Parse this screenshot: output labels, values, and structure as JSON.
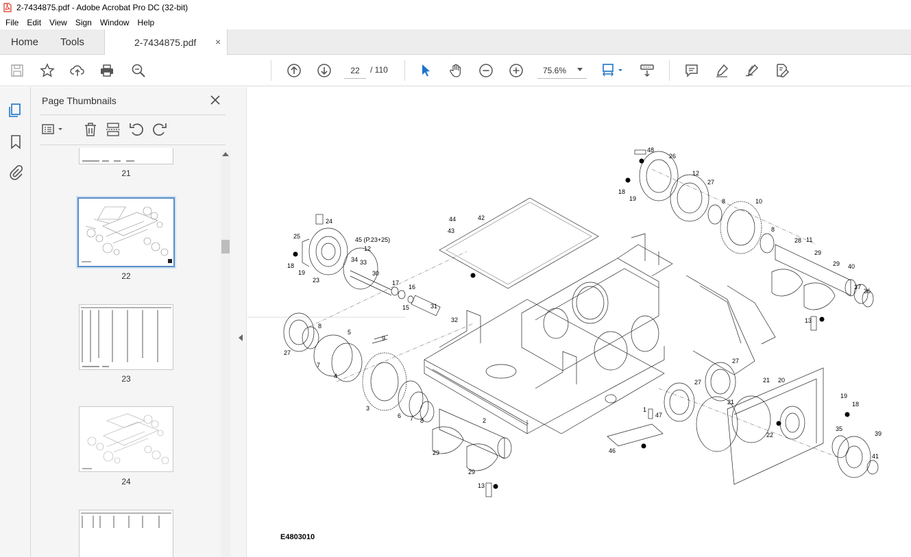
{
  "window": {
    "title": "2-7434875.pdf - Adobe Acrobat Pro DC (32-bit)"
  },
  "menu": [
    "File",
    "Edit",
    "View",
    "Sign",
    "Window",
    "Help"
  ],
  "tabs": {
    "home": "Home",
    "tools": "Tools",
    "document": "2-7434875.pdf",
    "close": "×"
  },
  "toolbar": {
    "current_page": "22",
    "page_total": "/ 110",
    "zoom": "75.6%"
  },
  "thumbnails_panel": {
    "title": "Page Thumbnails",
    "pages": [
      {
        "label": "21",
        "kind": "table"
      },
      {
        "label": "22",
        "kind": "drawing",
        "selected": true
      },
      {
        "label": "23",
        "kind": "table"
      },
      {
        "label": "24",
        "kind": "drawing"
      },
      {
        "label": "",
        "kind": "table"
      }
    ]
  },
  "document": {
    "drawing_code": "E4803010",
    "callouts": [
      {
        "t": "48"
      },
      {
        "t": "26"
      },
      {
        "t": "12"
      },
      {
        "t": "27"
      },
      {
        "t": "18"
      },
      {
        "t": "19"
      },
      {
        "t": "8"
      },
      {
        "t": "10"
      },
      {
        "t": "8"
      },
      {
        "t": "28"
      },
      {
        "t": "11"
      },
      {
        "t": "29"
      },
      {
        "t": "29"
      },
      {
        "t": "40"
      },
      {
        "t": "37"
      },
      {
        "t": "36"
      },
      {
        "t": "13"
      },
      {
        "t": "44"
      },
      {
        "t": "42"
      },
      {
        "t": "43"
      },
      {
        "t": "24"
      },
      {
        "t": "25"
      },
      {
        "t": "45 (P.23+25)"
      },
      {
        "t": "12"
      },
      {
        "t": "34"
      },
      {
        "t": "33"
      },
      {
        "t": "30"
      },
      {
        "t": "18"
      },
      {
        "t": "19"
      },
      {
        "t": "23"
      },
      {
        "t": "17"
      },
      {
        "t": "16"
      },
      {
        "t": "15"
      },
      {
        "t": "31"
      },
      {
        "t": "32"
      },
      {
        "t": "8"
      },
      {
        "t": "5"
      },
      {
        "t": "27"
      },
      {
        "t": "7"
      },
      {
        "t": "4"
      },
      {
        "t": "9"
      },
      {
        "t": "3"
      },
      {
        "t": "6"
      },
      {
        "t": "7"
      },
      {
        "t": "8"
      },
      {
        "t": "2"
      },
      {
        "t": "29"
      },
      {
        "t": "29"
      },
      {
        "t": "13"
      },
      {
        "t": "1"
      },
      {
        "t": "47"
      },
      {
        "t": "46"
      },
      {
        "t": "27"
      },
      {
        "t": "27"
      },
      {
        "t": "21"
      },
      {
        "t": "20"
      },
      {
        "t": "21"
      },
      {
        "t": "22"
      },
      {
        "t": "19"
      },
      {
        "t": "18"
      },
      {
        "t": "35"
      },
      {
        "t": "39"
      },
      {
        "t": "41"
      }
    ]
  }
}
